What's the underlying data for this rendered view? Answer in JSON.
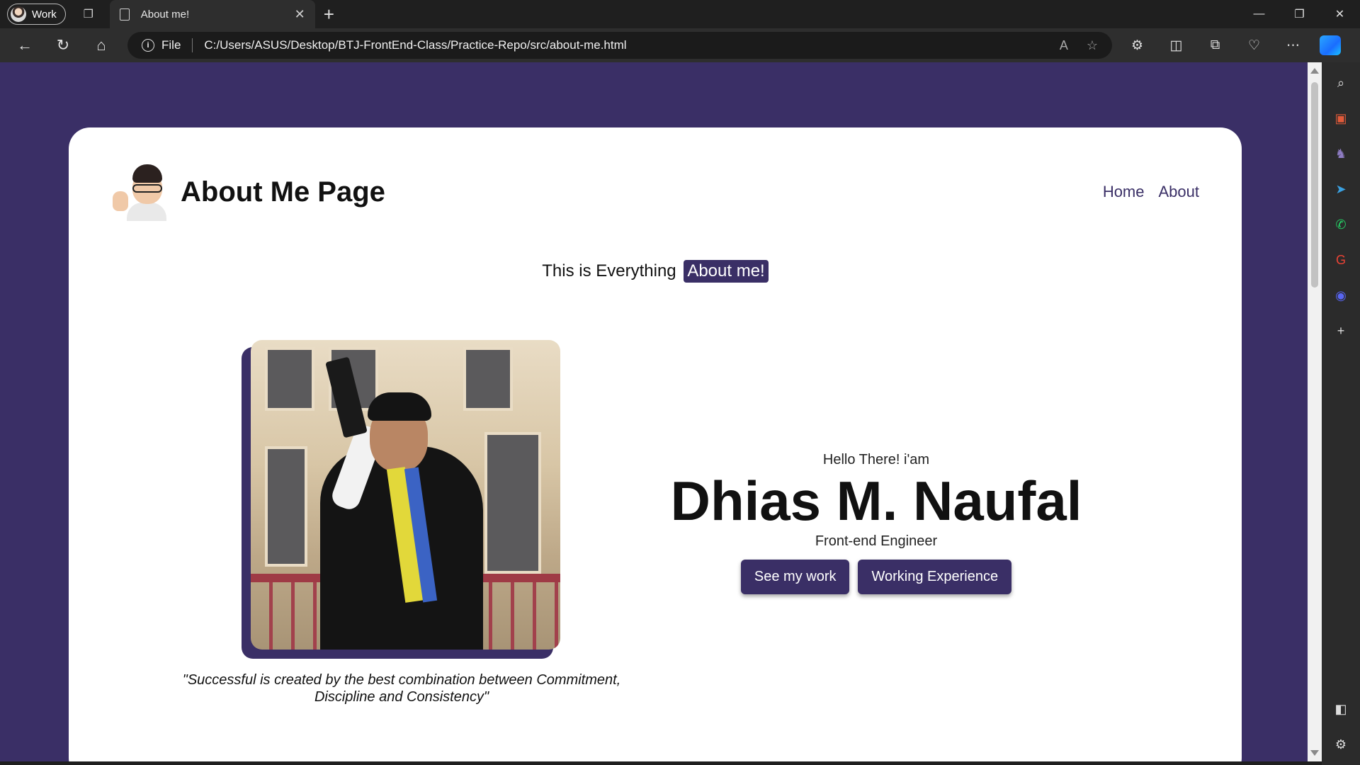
{
  "browser": {
    "profile_label": "Work",
    "tab_title": "About me!",
    "url_scheme_label": "File",
    "url": "C:/Users/ASUS/Desktop/BTJ-FrontEnd-Class/Practice-Repo/src/about-me.html"
  },
  "page": {
    "title": "About Me Page",
    "nav": {
      "home": "Home",
      "about": "About"
    },
    "tagline": {
      "text": "This is Everything",
      "badge": "About me!"
    },
    "hero": {
      "greeting": "Hello There! i'am",
      "name": "Dhias M. Naufal",
      "role": "Front-end Engineer",
      "primary_button": "See my work",
      "secondary_button": "Working Experience"
    },
    "quote": "\"Successful is created by the best combination between Commitment, Discipline and Consistency\""
  },
  "colors": {
    "accent": "#3a2f66",
    "chrome_dark": "#1f1f1f",
    "chrome_mid": "#2e2e2e"
  }
}
